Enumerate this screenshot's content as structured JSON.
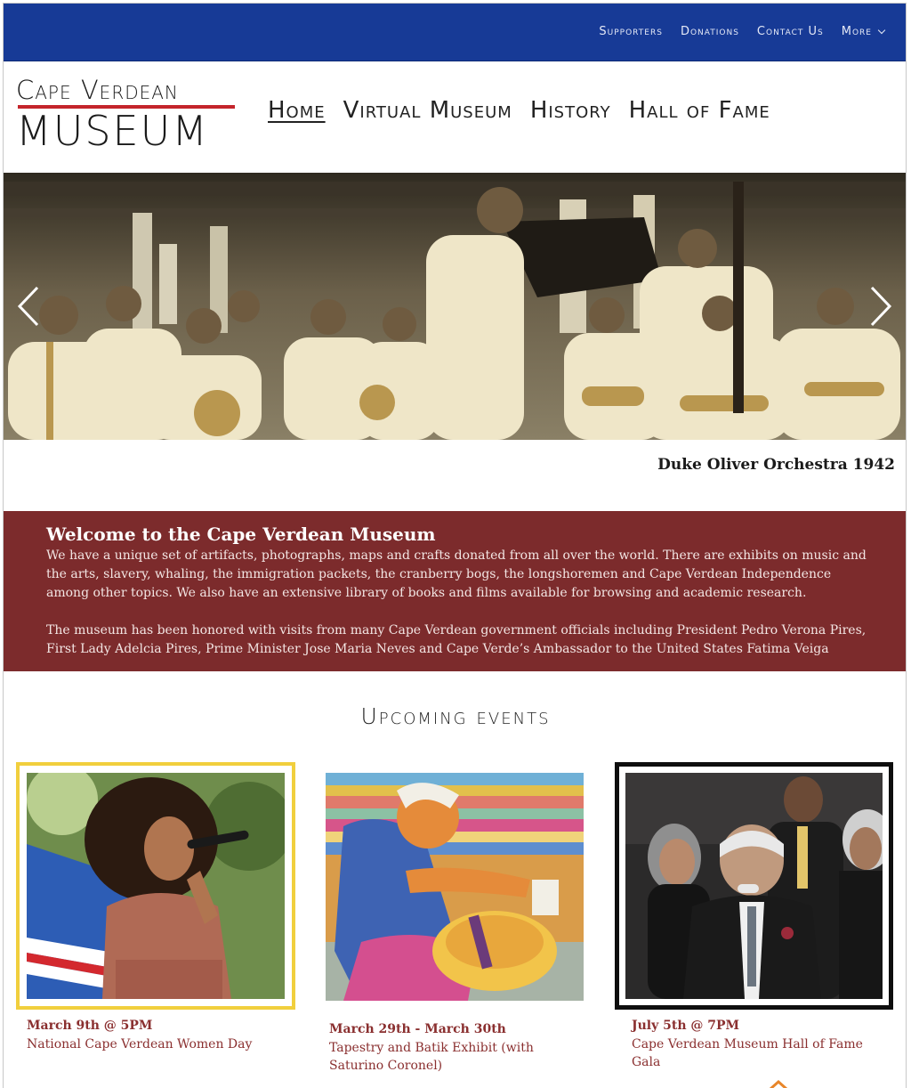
{
  "topbar": {
    "links": [
      "Supporters",
      "Donations",
      "Contact Us"
    ],
    "more_label": "More"
  },
  "logo": {
    "line1": "Cape Verdean",
    "line2": "MUSEUM"
  },
  "mainnav": {
    "items": [
      "Home",
      "Virtual Museum",
      "History",
      "Hall of Fame"
    ]
  },
  "hero": {
    "caption": "Duke Oliver Orchestra 1942"
  },
  "welcome": {
    "heading": "Welcome to the Cape Verdean Museum",
    "para1": "We have a unique set of artifacts, photographs, maps and crafts donated from all over the world. There are exhibits on music and the arts, slavery, whaling, the immigration packets, the cranberry bogs,  the longshoremen and Cape Verdean Independence among other topics. We also have an extensive  library of books and films available for browsing and academic research.",
    "para2": "The museum has been honored with visits from many Cape Verdean government officials including President Pedro Verona Pires, First Lady Adelcia Pires, Prime Minister Jose Maria Neves and Cape Verde’s Ambassador to the United States Fatima Veiga"
  },
  "events": {
    "heading": "Upcoming events",
    "items": [
      {
        "date": "March 9th @ 5PM",
        "title": "National Cape Verdean Women Day"
      },
      {
        "date": "March 29th - March 30th",
        "title": "Tapestry and Batik Exhibit (with Saturino Coronel)"
      },
      {
        "date": "July 5th @ 7PM",
        "title": "Cape Verdean Museum Hall of Fame Gala"
      }
    ]
  },
  "colors": {
    "topbar": "#173a96",
    "welcome_band": "#7c2b2c",
    "logo_rule": "#c4242b",
    "event_text": "#8a2f2f"
  }
}
